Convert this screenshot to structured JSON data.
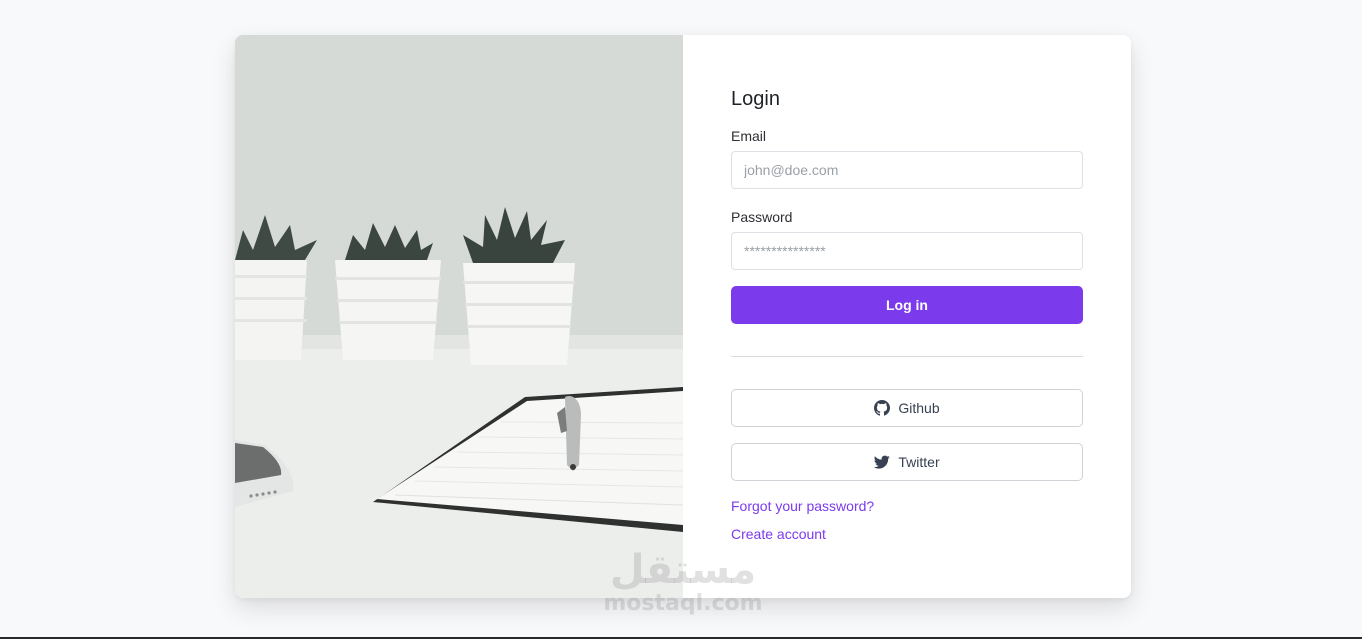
{
  "login": {
    "title": "Login",
    "email_label": "Email",
    "email_placeholder": "john@doe.com",
    "password_label": "Password",
    "password_placeholder": "***************",
    "submit_label": "Log in"
  },
  "social": {
    "github_label": "Github",
    "github_icon": "github-icon",
    "twitter_label": "Twitter",
    "twitter_icon": "twitter-icon"
  },
  "links": {
    "forgot_password": "Forgot your password?",
    "create_account": "Create account"
  },
  "watermark": {
    "arabic": "مستقل",
    "latin": "mostaql.com"
  },
  "colors": {
    "accent": "#7c3aed",
    "background": "#f8f9fb",
    "card": "#ffffff"
  }
}
